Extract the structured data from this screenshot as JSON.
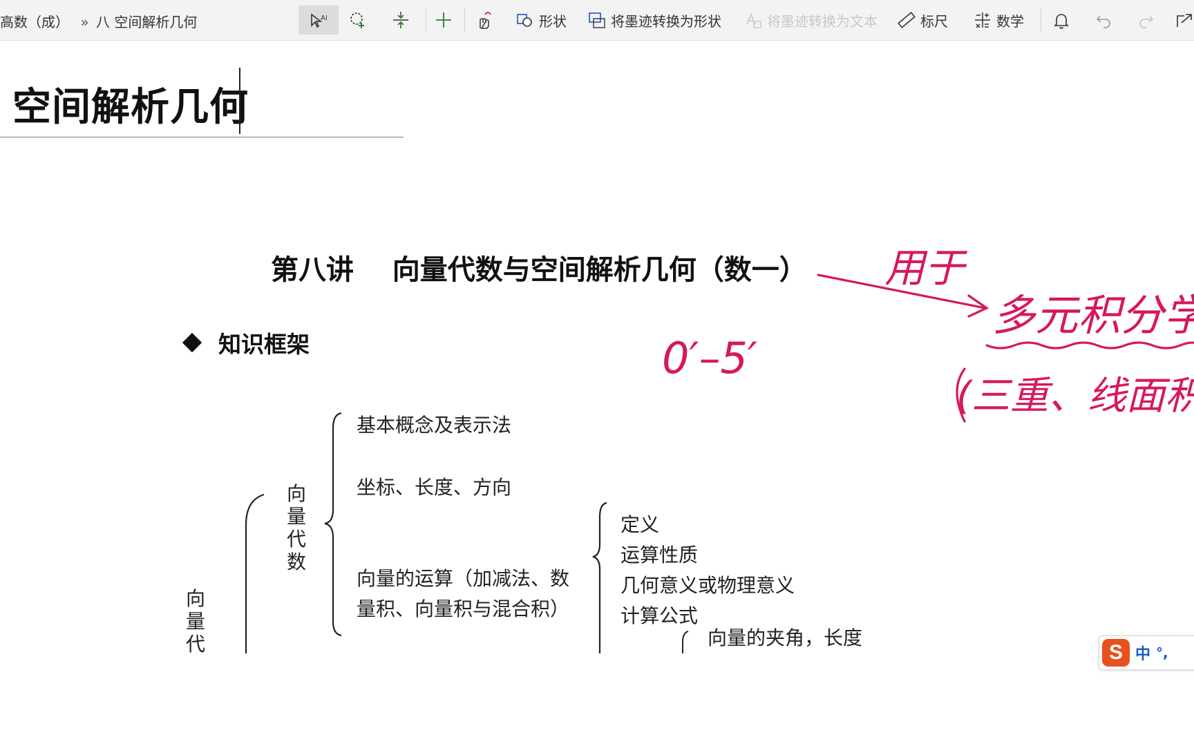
{
  "toolbar": {
    "breadcrumb_notebook": "高数（成）",
    "breadcrumb_sep": "»",
    "breadcrumb_page": "八 空间解析几何",
    "shapes_label": "形状",
    "ink_to_shape_label": "将墨迹转换为形状",
    "ink_to_text_label": "将墨迹转换为文本",
    "ruler_label": "标尺",
    "math_label": "数学",
    "icons": [
      "lasso-select-icon",
      "add-space-icon",
      "insert-space-icon",
      "plus-icon",
      "pan-touch-icon",
      "shapes-icon",
      "ink-to-shape-icon",
      "ink-to-text-icon",
      "ruler-icon",
      "math-icon",
      "bell-icon",
      "undo-icon",
      "redo-icon",
      "share-icon"
    ]
  },
  "page": {
    "title": "空间解析几何"
  },
  "document": {
    "lecture_title": "第八讲    向量代数与空间解析几何（数一）",
    "section_heading": "知识框架",
    "outer_branch_vertical": "向量代数",
    "inner_branch_vertical": "向量代数",
    "items": {
      "basic_concepts": "基本概念及表示法",
      "coordinates": "坐标、长度、方向",
      "operations_line1": "向量的运算（加减法、数",
      "operations_line2": "量积、向量积与混合积）"
    },
    "sub_items": {
      "definition": "定义",
      "properties": "运算性质",
      "meaning": "几何意义或物理意义",
      "formula": "计算公式",
      "angle_length": "向量的夹角，长度"
    }
  },
  "annotations": {
    "used_for": "用于",
    "target": "多元积分学",
    "detail": "(三重、线面积分",
    "score": "0′–5′",
    "ink_color": "#d6185f"
  },
  "ime": {
    "logo": "S",
    "lang": "中",
    "punct": "°,"
  }
}
